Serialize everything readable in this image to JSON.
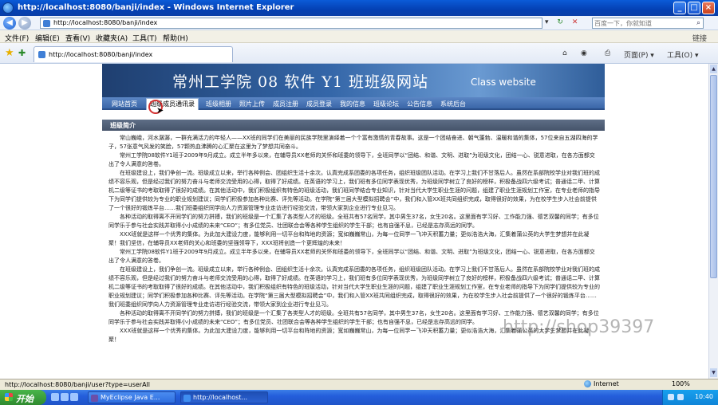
{
  "window": {
    "title": "http://localhost:8080/banji/index - Windows Internet Explorer",
    "minimize": "_",
    "maximize": "□",
    "close": "×"
  },
  "address": {
    "url": "http://localhost:8080/banji/index",
    "search_placeholder": "百度一下，你就知道",
    "dropdown": "▾",
    "refresh": "↻",
    "stop": "✕"
  },
  "menu": {
    "items": [
      "文件(F)",
      "编辑(E)",
      "查看(V)",
      "收藏夹(A)",
      "工具(T)",
      "帮助(H)"
    ],
    "links": "链接"
  },
  "tab": {
    "label": "http://localhost:8080/banji/index"
  },
  "toolbar": {
    "page_label": "页面(P) ▾",
    "tools_label": "工具(O) ▾"
  },
  "site": {
    "banner_title": "常州工学院  08 软件  Y1 班班级网站",
    "banner_en": "Class website",
    "nav": [
      "网站首页",
      "班级成员通讯录",
      "班级相册",
      "照片上传",
      "成员注册",
      "成员登录",
      "我的信息",
      "班级论坛",
      "公告信息",
      "系统后台"
    ],
    "section_title": "班级简介",
    "article": [
      "常山巍峨，河水潺潺，一群充满活力的年轻人——XX班的同学们在美丽的民族学院里演绎着一个个富有激情的青春故事。这是一个团结奋进、朝气蓬勃、温暖和谐的集体，57位来自五湖四海的学子，57张意气风发的笑脸，57颗热血沸腾的心汇聚在这里为了梦想共同奋斗。",
      "常州工学院08软件Y1班于2009年9月成立。成立半年多以来，在辅导员XX老师的关怀和班委的领导下，全班同学以“团结、和谐、文明、进取”为班级文化，团结一心、锐意进取，在各方面都交出了令人满意的答卷。",
      "在班级建设上，我们争创一流。班级成立以来，举行各种例会、团组织生活十余次。认真完成系团委的各项任务，组织班级团队活动。在学习上我们不甘落后人。虽然在系部院校学业对我们班的成绩不容乐观，但是经过我们的努力奋斗与老师交流受用的心得，取得了好成绩。在英语的学习上，我们班有多位同学表现优秀，为班级同学树立了良好的榜样，积极备战四六级考试；普通话二甲、计算机二级等证书的考取取得了很好的成绩。在其他活动中，我们积极组织有特色的班级活动，我们班同学结合专业知识，针对当代大学生职业生涯的问题，组建了职业生涯规划工作室，在专业老师的指导下为同学们提供较为专业的职业规划建议；同学们积极参加各种比赛、评先等活动。在学院“第三届大型模拟招聘会”中，我们和入管XX班共同组织完成，取得很好的效果，为在校学生步入社会前提供了一个很好的锻炼平台……我们班委组织同学向人力资源管理专业走访进行经验交流，带领大家到企业进行专业见习。",
      "各种活动的取得离不开同学们的努力拼搏，我们的班级是一个汇集了各类型人才的班级。全班共有57名同学，其中男生37名，女生20名。这里面有学习好、工作能力强、德艺双馨的同学；有多位同学乐于参与社会实践并取得小小成绩的未来“CEO”；有多位党员、壮团联合会等各种学生组织的学生干部；也有自强不息，已经是志存高远的同学。",
      "XXX班就是这样一个优秀的集体。为此加大建设力度，能够利用一切平台和阵地的资源；宽如巍巍常山，为每一位同学一飞冲天积蓄力量；更似浩浩大海，汇集着蒲公英的大学生梦想并在此凝聚！我们坚信，在辅导员XX老师的关心和班委的坚强领导下，XXX班将创造一个更辉煌的未来！",
      "常州工学院08软件Y1班于2009年9月成立。成立半年多以来，在辅导员XX老师的关怀和班委的领导下，全班同学以“团结、和谐、文明、进取”为班级文化，团结一心、锐意进取，在各方面都交出了令人满意的答卷。",
      "在班级建设上，我们争创一流。班级成立以来，举行各种例会、团组织生活十余次。认真完成系团委的各项任务，组织班级团队活动。在学习上我们不甘落后人。虽然在系部院校学业对我们班的成绩不容乐观，但是经过我们的努力奋斗与老师交流受用的心得，取得了好成绩。在英语的学习上，我们班有多位同学表现优秀，为班级同学树立了良好的榜样，积极备战四六级考试；普通话二甲、计算机二级等证书的考取取得了很好的成绩。在其他活动中，我们积极组织有特色的班级活动，针对当代大学生职业生涯的问题，组建了职业生涯规划工作室，在专业老师的指导下为同学们提供较为专业的职业规划建议；同学们积极参加各种比赛、评先等活动。在学院“第三届大型模拟招聘会”中，我们和入管XX班共同组织完成，取得很好的效果，为在校学生步入社会前提供了一个很好的锻炼平台……我们班委组织同学向人力资源管理专业走访进行经验交流，带领大家到企业进行专业见习。",
      "各种活动的取得离不开同学们的努力拼搏，我们的班级是一个汇集了各类型人才的班级。全班共有57名同学，其中男生37名，女生20名。这里面有学习好、工作能力强、德艺双馨的同学；有多位同学乐于参与社会实践并取得小小成绩的未来“CEO”；有多位党员、壮团联合会等各种学生组织的学生干部；也有自强不息，已经是志存高远的同学。",
      "XXX班就是这样一个优秀的集体。为此加大建设力度，能够利用一切平台和阵地的资源；宽如巍巍常山，为每一位同学一飞冲天积蓄力量；更似浩浩大海，汇集着蒲公英的大学生梦想并在此凝聚！"
    ],
    "watermark": "http://shop39397"
  },
  "status": {
    "url": "http://localhost:8080/banji/user?type=userAll",
    "zone": "Internet",
    "zoom": "100%"
  },
  "taskbar": {
    "start": "开始",
    "items": [
      "MyEclipse Java E...",
      "http://localhost..."
    ],
    "clock": "10:40"
  }
}
